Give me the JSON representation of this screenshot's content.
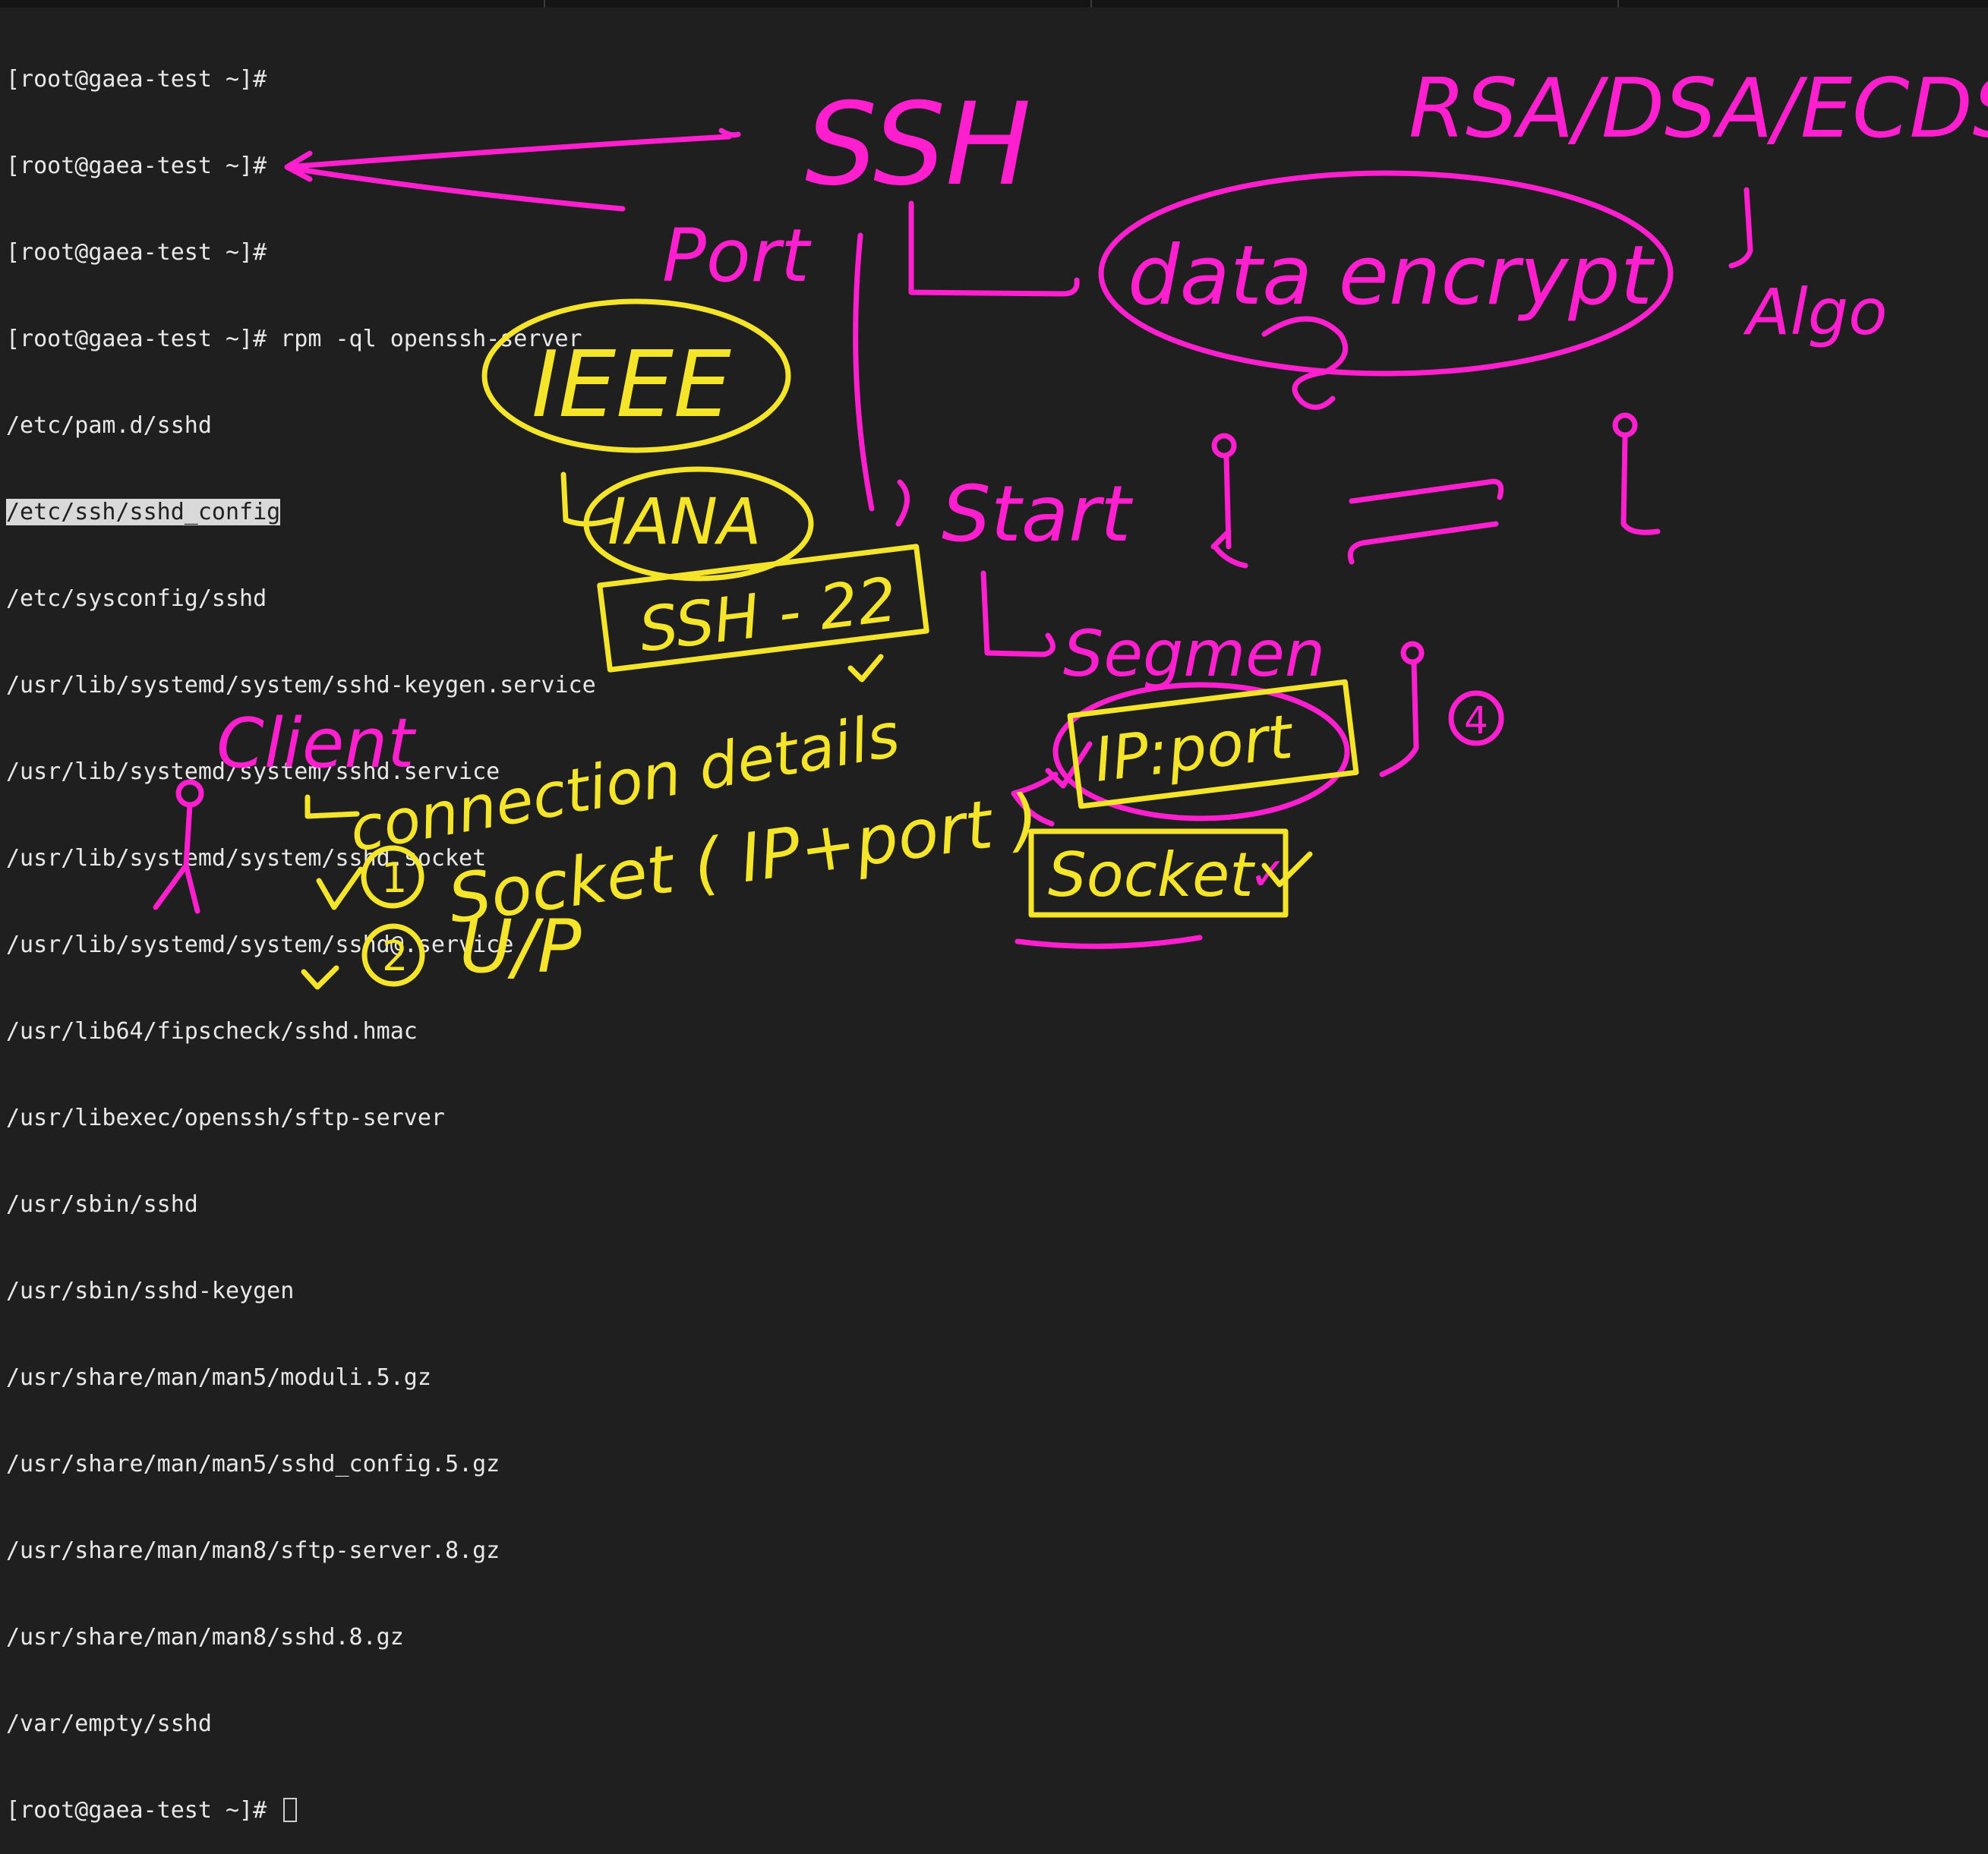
{
  "terminal": {
    "prompt": "[root@gaea-test ~]#",
    "command": "rpm -ql openssh-server",
    "output": [
      "/etc/pam.d/sshd",
      "/etc/ssh/sshd_config",
      "/etc/sysconfig/sshd",
      "/usr/lib/systemd/system/sshd-keygen.service",
      "/usr/lib/systemd/system/sshd.service",
      "/usr/lib/systemd/system/sshd.socket",
      "/usr/lib/systemd/system/sshd@.service",
      "/usr/lib64/fipscheck/sshd.hmac",
      "/usr/libexec/openssh/sftp-server",
      "/usr/sbin/sshd",
      "/usr/sbin/sshd-keygen",
      "/usr/share/man/man5/moduli.5.gz",
      "/usr/share/man/man5/sshd_config.5.gz",
      "/usr/share/man/man8/sftp-server.8.gz",
      "/usr/share/man/man8/sshd.8.gz",
      "/var/empty/sshd"
    ],
    "highlighted_index": 1
  },
  "annotations": {
    "colors": {
      "pink": "#ff1fce",
      "yellow": "#f5e52a"
    },
    "pink": {
      "ssh": "SSH",
      "algos": "RSA/DSA/ECDSA",
      "port": "Port",
      "data_encrypt": "data encrypt",
      "algo": "Algo",
      "start": "Start",
      "segment": "Segmen",
      "client": "Client",
      "circled_4": "4",
      "socket_check": "✓"
    },
    "yellow": {
      "ieee": "IEEE",
      "iana": "IANA",
      "ssh22": "SSH - 22",
      "connection_details": "connection details",
      "socket_ipport": "Socket ( IP+port )",
      "circled_1": "1",
      "circled_2": "2",
      "up": "U/P",
      "ip_port": "IP:port",
      "socket": "Socket"
    }
  }
}
